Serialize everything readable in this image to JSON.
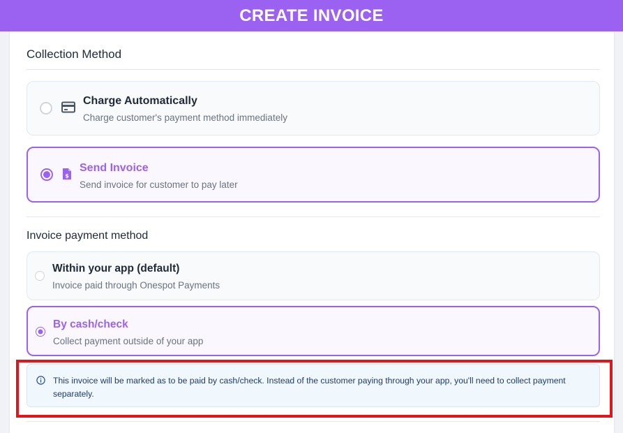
{
  "header": {
    "title": "CREATE INVOICE"
  },
  "collection_method": {
    "title": "Collection Method",
    "options": [
      {
        "title": "Charge Automatically",
        "description": "Charge customer's payment method immediately",
        "icon": "credit-card-icon",
        "selected": false
      },
      {
        "title": "Send Invoice",
        "description": "Send invoice for customer to pay later",
        "icon": "invoice-document-icon",
        "selected": true
      }
    ]
  },
  "payment_method": {
    "title": "Invoice payment method",
    "options": [
      {
        "title": "Within your app (default)",
        "description": "Invoice paid through Onespot Payments",
        "selected": false
      },
      {
        "title": "By cash/check",
        "description": "Collect payment outside of your app",
        "selected": true
      }
    ]
  },
  "info": {
    "icon": "info-icon",
    "text": "This invoice will be marked as to be paid by cash/check. Instead of the customer paying through your app, you'll need to collect payment separately."
  },
  "colors": {
    "accent": "#9b62f2",
    "highlight": "#e0161c",
    "info_bg": "#f0f7fd",
    "info_text": "#1e3a6e"
  }
}
